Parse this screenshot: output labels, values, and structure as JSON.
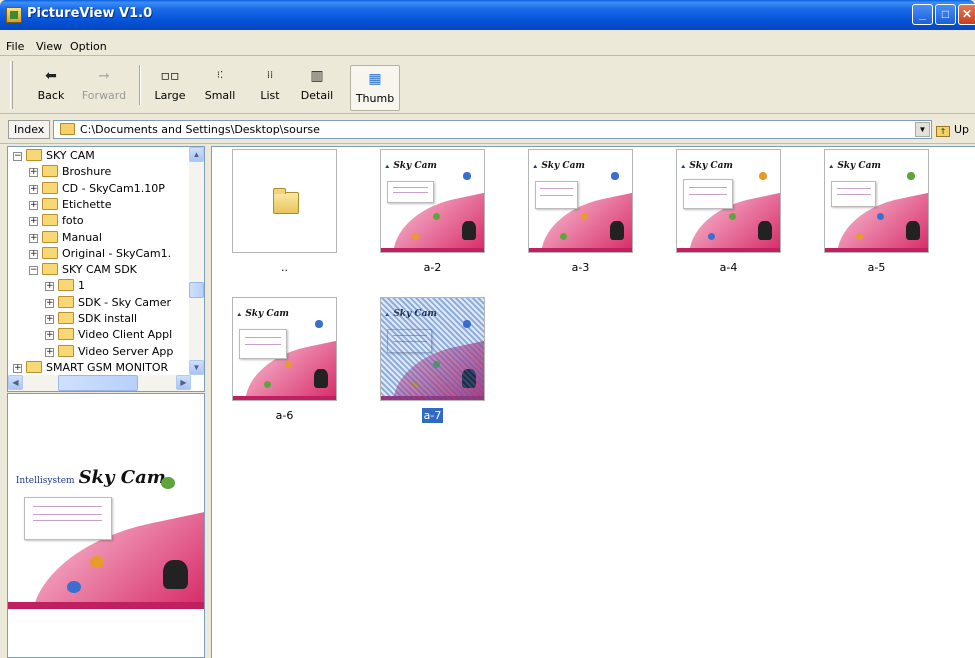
{
  "window": {
    "title": "PictureView V1.0"
  },
  "menu": [
    "File",
    "View",
    "Option"
  ],
  "toolbar": {
    "back": "Back",
    "forward": "Forward",
    "large": "Large",
    "small": "Small",
    "list": "List",
    "detail": "Detail",
    "thumb": "Thumb",
    "active_view": "Thumb"
  },
  "address": {
    "label": "Index",
    "path": "C:\\Documents and Settings\\Desktop\\sourse",
    "up": "Up"
  },
  "tree": [
    {
      "label": "SKY CAM",
      "sign": "−",
      "level": 0
    },
    {
      "label": "Broshure",
      "sign": "+",
      "level": 1
    },
    {
      "label": "CD - SkyCam1.10P",
      "sign": "+",
      "level": 1
    },
    {
      "label": "Etichette",
      "sign": "+",
      "level": 1
    },
    {
      "label": "foto",
      "sign": "+",
      "level": 1
    },
    {
      "label": "Manual",
      "sign": "+",
      "level": 1
    },
    {
      "label": "Original - SkyCam1.",
      "sign": "+",
      "level": 1
    },
    {
      "label": "SKY CAM SDK",
      "sign": "−",
      "level": 1
    },
    {
      "label": "1",
      "sign": "+",
      "level": 2
    },
    {
      "label": "SDK - Sky Camer",
      "sign": "+",
      "level": 2
    },
    {
      "label": "SDK install",
      "sign": "+",
      "level": 2
    },
    {
      "label": "Video Client Appl",
      "sign": "+",
      "level": 2
    },
    {
      "label": "Video Server App",
      "sign": "+",
      "level": 2
    },
    {
      "label": "SMART GSM MONITOR",
      "sign": "+",
      "level": 0
    }
  ],
  "preview": {
    "logo": "Intellisystem",
    "title": "Sky Cam"
  },
  "thumbnails": [
    {
      "label": "..",
      "kind": "folder",
      "selected": false
    },
    {
      "label": "a-2",
      "kind": "image",
      "selected": false
    },
    {
      "label": "a-3",
      "kind": "image",
      "selected": false
    },
    {
      "label": "a-4",
      "kind": "image",
      "selected": false
    },
    {
      "label": "a-5",
      "kind": "image",
      "selected": false
    },
    {
      "label": "a-6",
      "kind": "image",
      "selected": false
    },
    {
      "label": "a-7",
      "kind": "image",
      "selected": true
    }
  ],
  "thumb_image_title": "Sky Cam",
  "colors": {
    "titlebar": "#0a5fe0",
    "selection": "#316ac5",
    "pink": "#d8316c"
  }
}
